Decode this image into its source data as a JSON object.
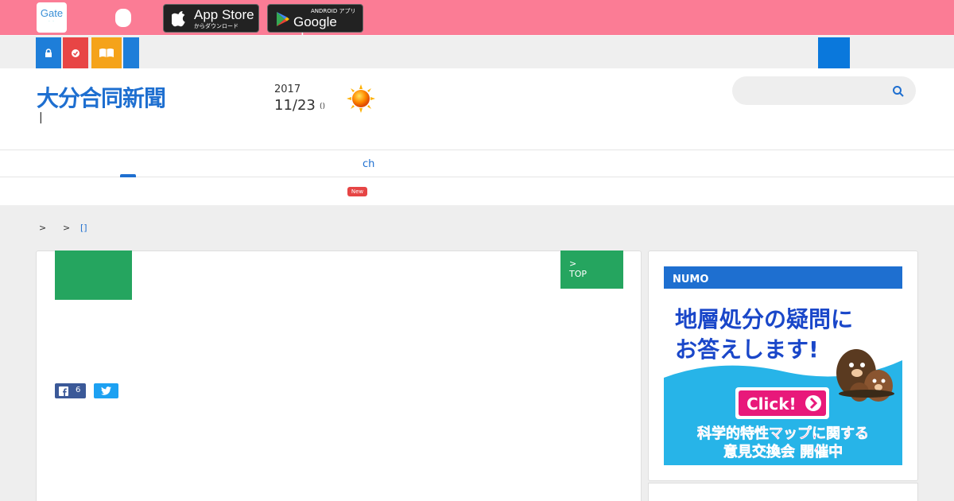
{
  "topbar": {
    "gate_logo": "Gate",
    "gate_logo_sub": "· ·",
    "appstore_main": "App Store",
    "appstore_sub": "からダウンロード",
    "gplay_sub": "ANDROID アプリ",
    "gplay_main": "Google play"
  },
  "header": {
    "masthead": "大分合同新聞",
    "masthead_sub": "|",
    "date_year": "2017",
    "date_md": "11/23",
    "date_dow": "()",
    "search_placeholder": ""
  },
  "nav": {
    "ch_label": "ch",
    "new_badge": "New"
  },
  "breadcrumb": {
    "sep1": ">",
    "sep2": ">",
    "current": "[]"
  },
  "article": {
    "top_link_arrow": ">",
    "top_link_label": "TOP",
    "fb_count": "6"
  },
  "ad": {
    "brand": "NUMO",
    "headline_1": "地層処分の疑問に",
    "headline_2": "お答えします!",
    "cta": "Click!",
    "footer_1": "科学的特性マップに関する",
    "footer_2": "意見交換会 開催中"
  },
  "colors": {
    "topbar": "#fb7c95",
    "brand_blue": "#1e6fd0",
    "green": "#25a55f",
    "red": "#e84545",
    "orange": "#f5a31a"
  }
}
